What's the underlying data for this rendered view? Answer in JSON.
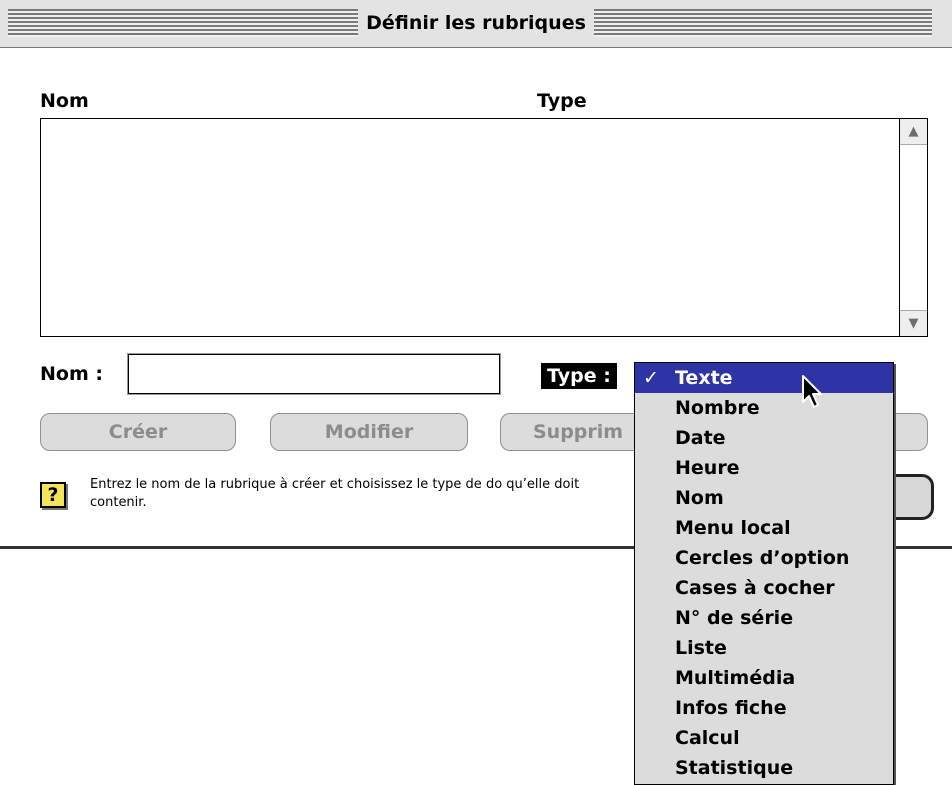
{
  "window": {
    "title": "Définir les rubriques"
  },
  "list": {
    "header_name": "Nom",
    "header_type": "Type"
  },
  "form": {
    "name_label": "Nom :",
    "name_value": "",
    "type_label": "Type :"
  },
  "buttons": {
    "create": "Créer",
    "modify": "Modifier",
    "delete_partial": "Supprim"
  },
  "help": {
    "text": "Entrez le nom de la rubrique à créer et choisissez le type de do qu’elle doit contenir.",
    "icon": "question-mark-icon"
  },
  "type_menu": {
    "selected": "Texte",
    "check_mark": "✓",
    "items": [
      "Texte",
      "Nombre",
      "Date",
      "Heure",
      "Nom",
      "Menu local",
      "Cercles d’option",
      "Cases à cocher",
      "N° de série",
      "Liste",
      "Multimédia",
      "Infos fiche",
      "Calcul",
      "Statistique"
    ]
  },
  "colors": {
    "menu_highlight": "#2e34a6",
    "button_disabled_text": "#8c8c8c",
    "help_icon_bg": "#f3e45a"
  }
}
